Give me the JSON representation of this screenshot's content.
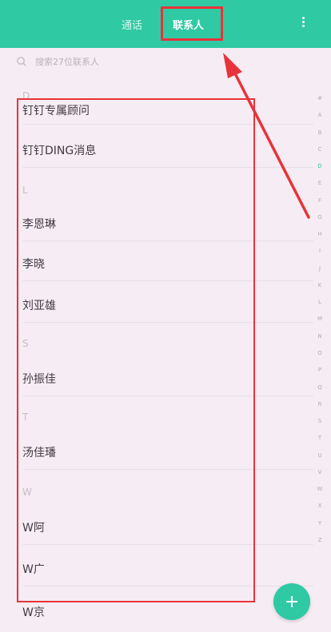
{
  "header": {
    "tabs": [
      {
        "label": "通话",
        "selected": false
      },
      {
        "label": "联系人",
        "selected": true
      }
    ],
    "menu_icon": "more-vert-icon"
  },
  "search": {
    "placeholder": "搜索27位联系人",
    "icon": "search-icon"
  },
  "contacts": {
    "rows": [
      {
        "type": "header",
        "text": "D"
      },
      {
        "type": "contact",
        "text": "钉钉专属顾问"
      },
      {
        "type": "contact",
        "text": "钉钉DING消息"
      },
      {
        "type": "header",
        "text": "L"
      },
      {
        "type": "contact",
        "text": "李恩琳"
      },
      {
        "type": "contact",
        "text": "李晓"
      },
      {
        "type": "contact",
        "text": "刘亚雄"
      },
      {
        "type": "header",
        "text": "S"
      },
      {
        "type": "contact",
        "text": "孙振佳"
      },
      {
        "type": "header",
        "text": "T"
      },
      {
        "type": "contact",
        "text": "汤佳璠"
      },
      {
        "type": "header",
        "text": "W"
      },
      {
        "type": "contact",
        "text": "W阿"
      },
      {
        "type": "contact",
        "text": "W广"
      },
      {
        "type": "contact",
        "text": "W京"
      }
    ]
  },
  "index_bar": {
    "letters": [
      "#",
      "A",
      "B",
      "C",
      "D",
      "E",
      "F",
      "G",
      "H",
      "I",
      "J",
      "K",
      "L",
      "M",
      "N",
      "O",
      "P",
      "Q",
      "R",
      "S",
      "T",
      "U",
      "V",
      "W",
      "X",
      "Y",
      "Z"
    ],
    "active": "D"
  },
  "fab": {
    "icon": "plus-icon"
  },
  "colors": {
    "accent": "#2fc9a3",
    "annotation": "#e8333a",
    "background": "#f6ecf3"
  }
}
